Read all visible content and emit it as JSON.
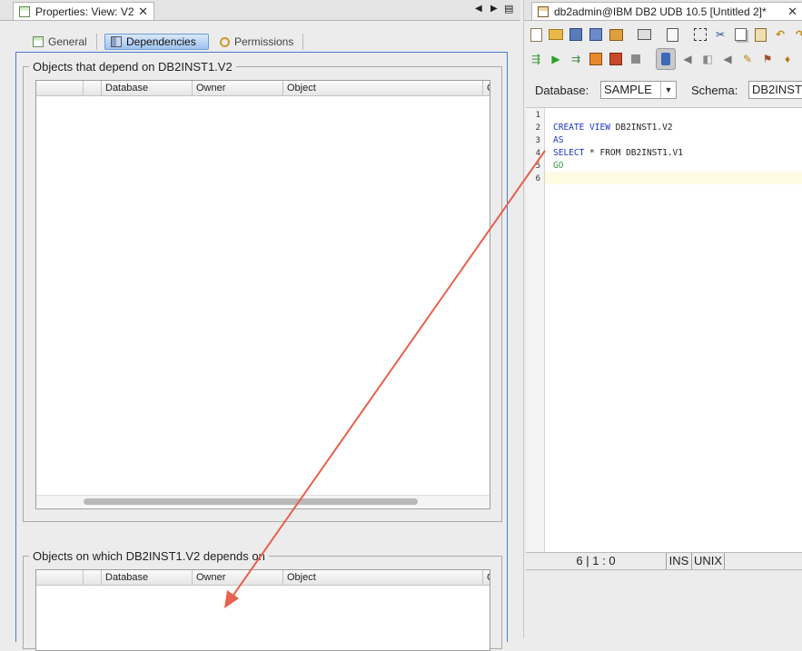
{
  "left_tab": {
    "title": "Properties: View: V2",
    "close": "✕"
  },
  "nav_controls": {
    "prev": "◀",
    "next": "▶",
    "menu": "▤"
  },
  "subtabs": [
    {
      "label": "General"
    },
    {
      "label": "Dependencies",
      "active": true
    },
    {
      "label": "Permissions"
    }
  ],
  "dependents_group": {
    "legend": "Objects that depend on DB2INST1.V2",
    "columns": [
      "",
      "Database",
      "Owner",
      "Object",
      "C"
    ]
  },
  "dependencies_group": {
    "legend": "Objects on which DB2INST1.V2 depends on",
    "columns": [
      "",
      "Database",
      "Owner",
      "Object",
      "C"
    ]
  },
  "right_tab": {
    "title": "db2admin@IBM DB2 UDB 10.5 [Untitled 2]*",
    "close": "✕"
  },
  "query_bar": {
    "database_label": "Database:",
    "database_value": "SAMPLE",
    "schema_label": "Schema:",
    "schema_value": "DB2INST"
  },
  "sql_editor": {
    "line_numbers": [
      "1",
      "2",
      "3",
      "4",
      "5",
      "6"
    ],
    "lines": [
      {
        "keyword": "",
        "rest": ""
      },
      {
        "keyword": "CREATE VIEW",
        "rest": " DB2INST1.V2"
      },
      {
        "keyword": "AS",
        "rest": ""
      },
      {
        "keyword": "SELECT",
        "rest": " * FROM DB2INST1.V1"
      },
      {
        "keyword": "GO",
        "rest": ""
      },
      {
        "keyword": "",
        "rest": ""
      }
    ]
  },
  "status_bar": {
    "position": "6 | 1 : 0",
    "mode": "INS",
    "line_ending": "UNIX"
  },
  "colors": {
    "accent_blue": "#4a7bd0",
    "keyword": "#1c37c8",
    "go_keyword": "#3b9a3b",
    "annotation_arrow": "#e8604f"
  }
}
